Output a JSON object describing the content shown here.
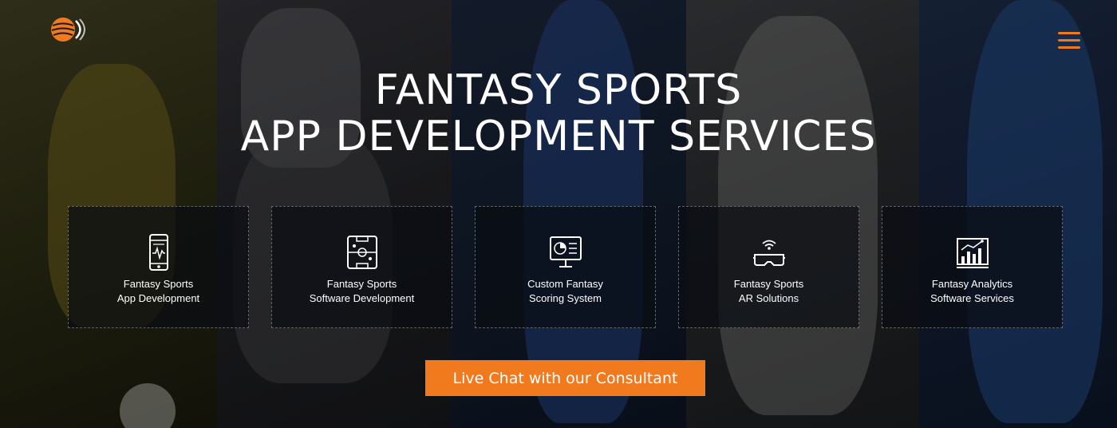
{
  "hero": {
    "title_line1": "FANTASY SPORTS",
    "title_line2": "APP DEVELOPMENT SERVICES"
  },
  "services": [
    {
      "line1": "Fantasy Sports",
      "line2": "App Development",
      "icon": "mobile-app-icon"
    },
    {
      "line1": "Fantasy Sports",
      "line2": "Software Development",
      "icon": "sports-field-icon"
    },
    {
      "line1": "Custom Fantasy",
      "line2": "Scoring System",
      "icon": "monitor-chart-icon"
    },
    {
      "line1": "Fantasy Sports",
      "line2": "AR Solutions",
      "icon": "vr-headset-icon"
    },
    {
      "line1": "Fantasy Analytics",
      "line2": "Software Services",
      "icon": "analytics-chart-icon"
    }
  ],
  "cta": {
    "label": "Live Chat with our Consultant"
  },
  "colors": {
    "accent": "#f27a1e",
    "card_bg": "rgba(10,12,18,0.72)"
  }
}
